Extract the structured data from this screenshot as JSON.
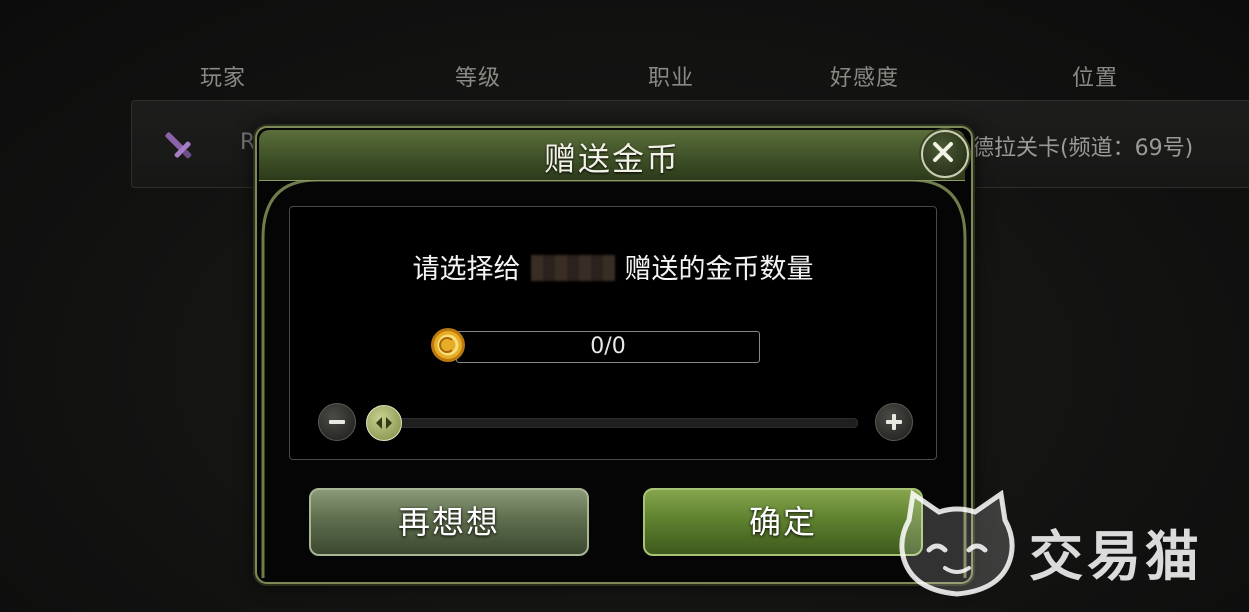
{
  "friend_list": {
    "headers": {
      "player": "玩家",
      "level": "等级",
      "class": "职业",
      "affinity": "好感度",
      "location": "位置"
    },
    "row": {
      "name_initial": "R",
      "location": "德拉关卡(频道：69号)"
    }
  },
  "dialog": {
    "title": "赠送金币",
    "prompt_before": "请选择给",
    "prompt_after": "赠送的金币数量",
    "amount": "0/0",
    "slider_value": 0,
    "cancel_label": "再想想",
    "confirm_label": "确定"
  },
  "watermark": {
    "text": "交易猫"
  },
  "colors": {
    "accent_green": "#5f8230",
    "frame": "#7d8a58",
    "coin_gold": "#e0a21c"
  },
  "icons": [
    "sword-icon",
    "close-icon",
    "coin-icon",
    "minus-icon",
    "plus-icon",
    "slider-arrows-icon",
    "cat-logo-icon"
  ]
}
